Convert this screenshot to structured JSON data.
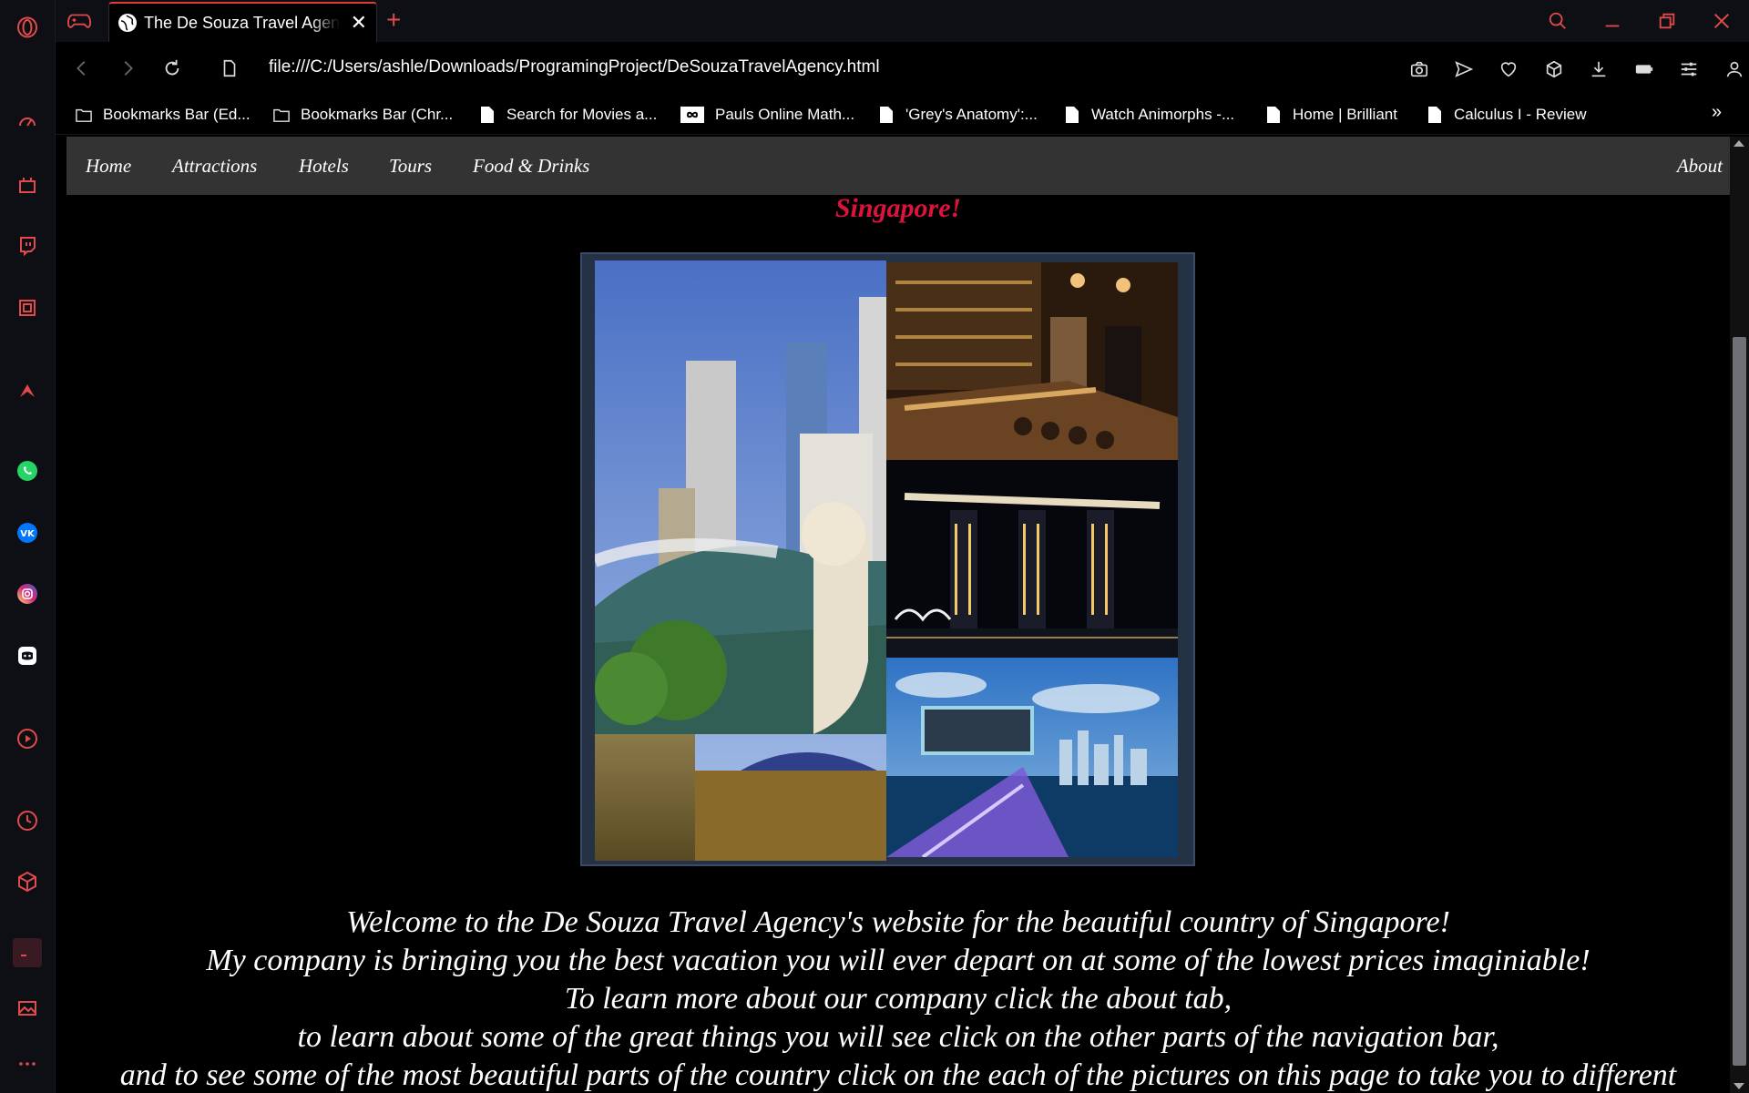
{
  "browser": {
    "tab": {
      "title": "The De Souza Travel Agency",
      "close_label": "✕"
    },
    "new_tab_label": "+",
    "url": "file:///C:/Users/ashle/Downloads/ProgramingProject/DeSouzaTravelAgency.html",
    "bookmarks": [
      {
        "label": "Bookmarks Bar (Ed...",
        "icon": "folder-icon"
      },
      {
        "label": "Bookmarks Bar (Chr...",
        "icon": "folder-icon"
      },
      {
        "label": "Search for Movies a...",
        "icon": "page-icon"
      },
      {
        "label": "Pauls Online Math...",
        "icon": "infinity-icon"
      },
      {
        "label": "'Grey's Anatomy':...",
        "icon": "page-icon"
      },
      {
        "label": "Watch Animorphs -...",
        "icon": "page-icon"
      },
      {
        "label": "Home | Brilliant",
        "icon": "page-icon"
      },
      {
        "label": "Calculus I - Review",
        "icon": "page-icon"
      }
    ],
    "bookmarks_more": "»",
    "accent": "#e03a3a"
  },
  "site": {
    "nav": {
      "home": "Home",
      "attractions": "Attractions",
      "hotels": "Hotels",
      "tours": "Tours",
      "food": "Food & Drinks",
      "about": "About"
    },
    "heading": "Singapore!",
    "heading_color": "#dc143c",
    "welcome_lines": [
      "Welcome to the De Souza Travel Agency's website for the beautiful country of Singapore!",
      "My company is bringing you the best vacation you will ever depart on at some of the lowest prices imaginiable!",
      "To learn more about our company click the about tab,",
      "to learn about some of the great things you will see click on the other parts of the navigation bar,",
      "and to see some of the most beautiful parts of the country click on the each of the pictures on this page to take you to different"
    ]
  }
}
